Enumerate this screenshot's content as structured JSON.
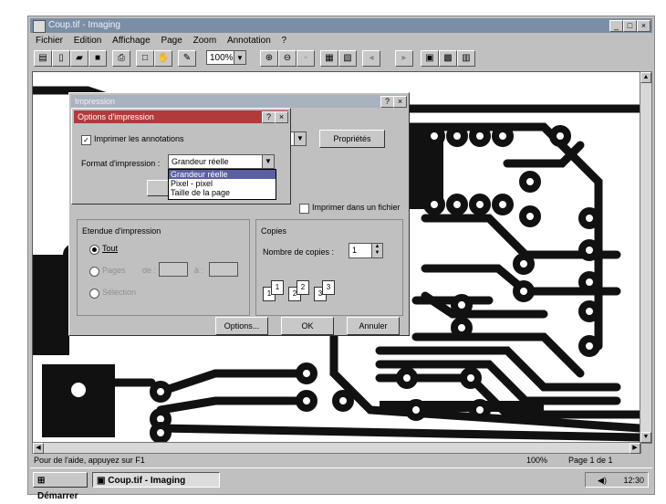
{
  "window": {
    "title": "Coup.tif - Imaging",
    "minimize": "_",
    "maximize": "□",
    "close": "×"
  },
  "menu": [
    "Fichier",
    "Edition",
    "Affichage",
    "Page",
    "Zoom",
    "Annotation",
    "?"
  ],
  "toolbar": {
    "zoom_value": "100%"
  },
  "print_dialog": {
    "title": "Impression",
    "help_button": "?",
    "close_button": "×",
    "properties_button": "Propriétés",
    "print_to_file_label": "Imprimer dans un fichier",
    "range_group_title": "Etendue d'impression",
    "range_all": "Tout",
    "range_pages": "Pages",
    "range_from": "de :",
    "range_to": "à :",
    "range_selection": "Sélection",
    "copies_group_title": "Copies",
    "copies_label": "Nombre de copies :",
    "copies_value": "1",
    "collate_labels": [
      "1",
      "1",
      "2",
      "2",
      "3",
      "3"
    ],
    "options_button": "Options...",
    "ok_button": "OK",
    "cancel_button": "Annuler"
  },
  "options_dialog": {
    "title": "Options d'impression",
    "help_button": "?",
    "close_button": "×",
    "print_annotations_label": "Imprimer les annotations",
    "format_label": "Format d'impression :",
    "format_value": "Grandeur réelle",
    "format_options": [
      "Grandeur réelle",
      "Pixel - pixel",
      "Taille de la page"
    ],
    "format_selected_index": 0
  },
  "status": {
    "help_text": "Pour de l'aide, appuyez sur F1",
    "zoom": "100%",
    "page": "Page 1 de 1"
  },
  "taskbar": {
    "start_label": "Démarrer",
    "task_label": "Coup.tif - Imaging",
    "clock": "12:30"
  }
}
